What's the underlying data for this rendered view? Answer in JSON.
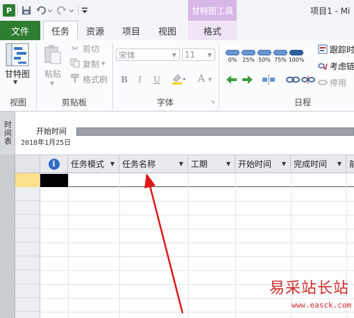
{
  "titlebar": {
    "context_title": "甘特图工具",
    "project_title": "项目1 - Mi",
    "qat": {
      "save_icon": "save-icon",
      "undo_icon": "undo-icon",
      "redo_icon": "redo-icon",
      "customize_icon": "customize-qat-icon"
    }
  },
  "tabs": {
    "file": "文件",
    "task": "任务",
    "resource": "资源",
    "project": "项目",
    "view": "视图",
    "format": "格式"
  },
  "ribbon": {
    "view_group": {
      "label": "视图",
      "gantt_button": "甘特图"
    },
    "clipboard_group": {
      "label": "剪贴板",
      "paste": "粘贴",
      "cut": "剪切",
      "copy": "复制",
      "format_painter": "格式刷"
    },
    "font_group": {
      "label": "字体",
      "font_name": "宋体",
      "font_size": "11",
      "bold": "B",
      "italic": "I",
      "underline": "U",
      "font_color": "A"
    },
    "schedule_group": {
      "label": "日程",
      "pct": [
        "0%",
        "25%",
        "50%",
        "75%",
        "100%"
      ],
      "track": "跟踪时",
      "respect_links": "考虑链",
      "deactivate": "停用"
    }
  },
  "timeline": {
    "side_label": "时间表",
    "start_label": "开始时间",
    "start_date": "2018年1月25日"
  },
  "grid": {
    "columns": [
      "任务模式",
      "任务名称",
      "工期",
      "开始时间",
      "完成时间",
      "前"
    ],
    "info_icon": "info-icon"
  },
  "colors": {
    "file_tab": "#2e7d32",
    "context_tab": "#d8b7e8",
    "selected_row": "#fce08a",
    "arrow": "#e01515"
  },
  "watermark": {
    "text": "易采站长站",
    "url": "www.easck.com"
  }
}
